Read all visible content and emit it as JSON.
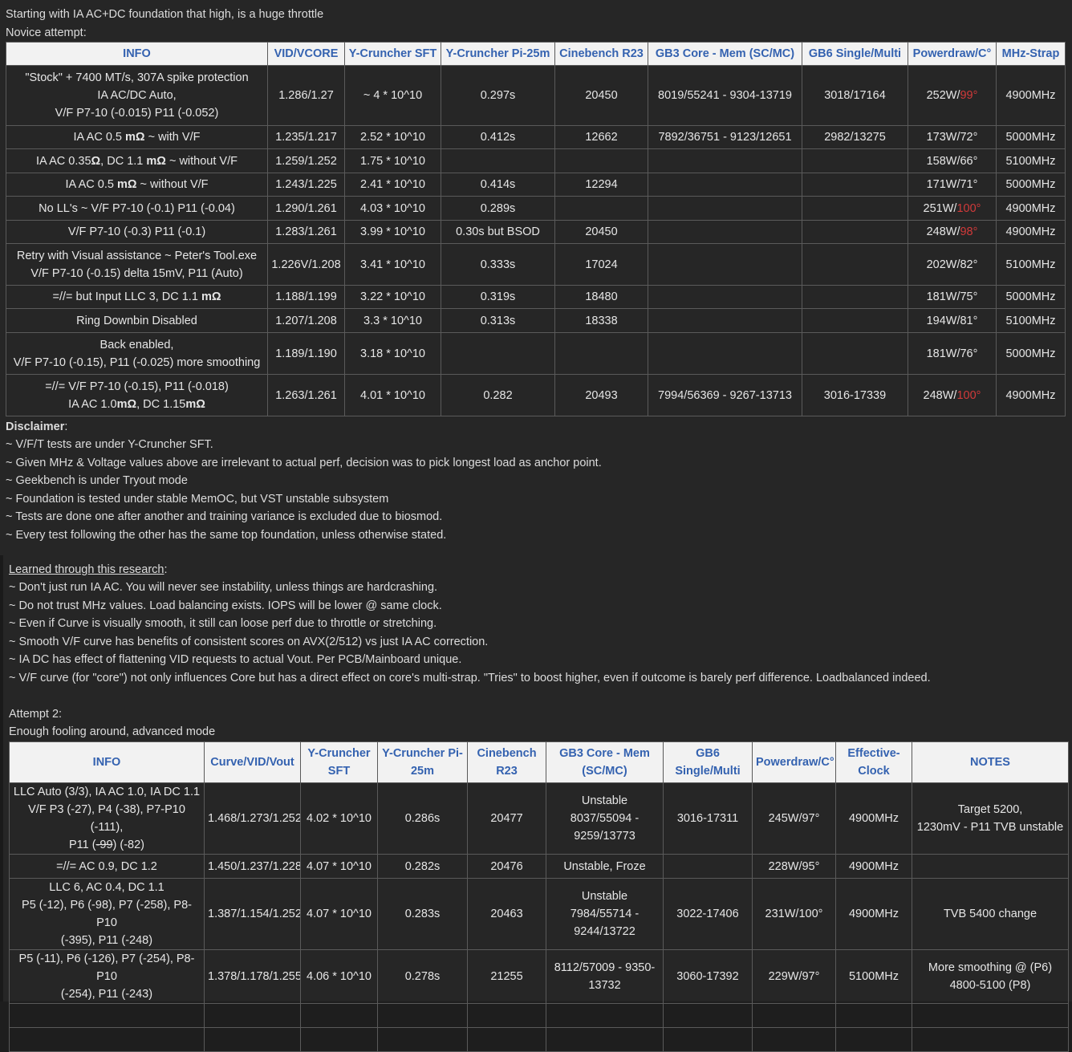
{
  "intro": {
    "line1": "Starting with IA AC+DC foundation that high, is a huge throttle",
    "line2": "Novice attempt:"
  },
  "table1": {
    "headers": [
      "INFO",
      "VID/VCORE",
      "Y-Cruncher SFT",
      "Y-Cruncher Pi-25m",
      "Cinebench R23",
      "GB3 Core - Mem (SC/MC)",
      "GB6 Single/Multi",
      "Powerdraw/C°",
      "MHz-Strap"
    ],
    "rows": [
      {
        "info": [
          "\"Stock\" + 7400 MT/s, 307A spike protection",
          "IA AC/DC Auto,",
          "V/F P7-10 (-0.015) P11 (-0.052)"
        ],
        "vid": "1.286/1.27",
        "sft": "~ 4 * 10^10",
        "pi": "0.297s",
        "cb": "20450",
        "gb3": "8019/55241 - 9304-13719",
        "gb6": "3018/17164",
        "pw": "252W/",
        "temp": "99°",
        "hot": true,
        "mhz": "4900MHz"
      },
      {
        "info_pre": "IA AC 0.5 ",
        "info_bold": "mΩ",
        "info_post": " ~ with V/F",
        "vid": "1.235/1.217",
        "sft": "2.52 * 10^10",
        "pi": "0.412s",
        "cb": "12662",
        "gb3": "7892/36751 - 9123/12651",
        "gb6": "2982/13275",
        "pw": "173W/",
        "temp": "72°",
        "hot": false,
        "mhz": "5000MHz"
      },
      {
        "info_pre": "IA AC 0.35",
        "info_bold": "Ω",
        "info_mid": ", DC 1.1 ",
        "info_bold2": "mΩ",
        "info_post": " ~ without V/F",
        "vid": "1.259/1.252",
        "sft": "1.75 * 10^10",
        "pi": "",
        "cb": "",
        "gb3": "",
        "gb6": "",
        "pw": "158W/",
        "temp": "66°",
        "hot": false,
        "mhz": "5100MHz"
      },
      {
        "info_pre": "IA AC 0.5 ",
        "info_bold": "mΩ",
        "info_post": " ~ without V/F",
        "vid": "1.243/1.225",
        "sft": "2.41 * 10^10",
        "pi": "0.414s",
        "cb": "12294",
        "gb3": "",
        "gb6": "",
        "pw": "171W/",
        "temp": "71°",
        "hot": false,
        "mhz": "5000MHz"
      },
      {
        "info": [
          "No LL's ~ V/F P7-10 (-0.1) P11 (-0.04)"
        ],
        "vid": "1.290/1.261",
        "sft": "4.03 * 10^10",
        "pi": "0.289s",
        "cb": "",
        "gb3": "",
        "gb6": "",
        "pw": "251W/",
        "temp": "100°",
        "hot": true,
        "mhz": "4900MHz"
      },
      {
        "info": [
          "V/F P7-10 (-0.3) P11 (-0.1)"
        ],
        "vid": "1.283/1.261",
        "sft": "3.99 * 10^10",
        "pi": "0.30s but BSOD",
        "cb": "20450",
        "gb3": "",
        "gb6": "",
        "pw": "248W/",
        "temp": "98°",
        "hot": true,
        "mhz": "4900MHz"
      },
      {
        "info": [
          "Retry with Visual assistance ~ Peter's Tool.exe",
          "V/F P7-10 (-0.15) delta 15mV, P11 (Auto)"
        ],
        "vid": "1.226V/1.208",
        "sft": "3.41 * 10^10",
        "pi": "0.333s",
        "cb": "17024",
        "gb3": "",
        "gb6": "",
        "pw": "202W/",
        "temp": "82°",
        "hot": false,
        "mhz": "5100MHz"
      },
      {
        "info_pre": "=//= but Input LLC 3, DC 1.1 ",
        "info_bold": "mΩ",
        "info_post": "",
        "vid": "1.188/1.199",
        "sft": "3.22 * 10^10",
        "pi": "0.319s",
        "cb": "18480",
        "gb3": "",
        "gb6": "",
        "pw": "181W/",
        "temp": "75°",
        "hot": false,
        "mhz": "5000MHz"
      },
      {
        "info": [
          "Ring Downbin Disabled"
        ],
        "vid": "1.207/1.208",
        "sft": "3.3 * 10^10",
        "pi": "0.313s",
        "cb": "18338",
        "gb3": "",
        "gb6": "",
        "pw": "194W/",
        "temp": "81°",
        "hot": false,
        "mhz": "5100MHz"
      },
      {
        "info": [
          "Back enabled,",
          "V/F P7-10 (-0.15), P11 (-0.025) more smoothing"
        ],
        "vid": "1.189/1.190",
        "sft": "3.18 * 10^10",
        "pi": "",
        "cb": "",
        "gb3": "",
        "gb6": "",
        "pw": "181W/",
        "temp": "76°",
        "hot": false,
        "mhz": "5000MHz"
      },
      {
        "info_l1": "=//= V/F P7-10 (-0.15), P11 (-0.018)",
        "info_l2_pre": "IA AC 1.0",
        "info_l2_b1": "mΩ",
        "info_l2_mid": ", DC 1.15",
        "info_l2_b2": "mΩ",
        "vid": "1.263/1.261",
        "sft": "4.01 * 10^10",
        "pi": "0.282",
        "cb": "20493",
        "gb3": "7994/56369 - 9267-13713",
        "gb6": "3016-17339",
        "pw": "248W/",
        "temp": "100°",
        "hot": true,
        "mhz": "4900MHz"
      }
    ]
  },
  "disclaimer": {
    "title": "Disclaimer",
    "colon": ":",
    "lines": [
      "~ V/F/T tests are under Y-Cruncher SFT.",
      "~ Given MHz & Voltage values above are irrelevant to actual perf, decision was to pick longest load as anchor point.",
      "~ Geekbench is under Tryout mode",
      "~ Foundation is tested under stable MemOC, but VST unstable subsystem",
      "~ Tests are done one after another and training variance is excluded due to biosmod.",
      "~ Every test following the other has the same top foundation, unless otherwise stated."
    ]
  },
  "learned": {
    "title": "Learned through this research",
    "colon": ":",
    "lines": [
      "~ Don't just run IA AC. You will never see instability, unless things are hardcrashing.",
      "~ Do not trust MHz values. Load balancing exists. IOPS will be lower @ same clock.",
      "~ Even if Curve is visually smooth, it still can loose perf due to throttle or stretching.",
      "~ Smooth V/F curve has benefits of consistent scores on AVX(2/512) vs just IA AC correction.",
      "~ IA DC has effect of flattening VID requests to actual Vout. Per PCB/Mainboard unique.",
      "~ V/F curve (for \"core\") not only influences Core but has a direct effect on core's multi-strap. \"Tries\" to boost higher, even if outcome is barely perf difference. Loadbalanced indeed."
    ]
  },
  "attempt2": {
    "line1": "Attempt 2:",
    "line2": "Enough fooling around, advanced mode"
  },
  "table2": {
    "headers": [
      "INFO",
      "Curve/VID/Vout",
      "Y-Cruncher SFT",
      "Y-Cruncher Pi-25m",
      "Cinebench R23",
      "GB3 Core - Mem (SC/MC)",
      "GB6 Single/Multi",
      "Powerdraw/C°",
      "Effective-Clock",
      "NOTES"
    ],
    "rows": [
      {
        "info_l1": "LLC Auto (3/3), IA AC 1.0, IA DC 1.1",
        "info_l2": "V/F P3 (-27), P4 (-38), P7-P10 (-111),",
        "info_l3a": "P11 (",
        "info_l3s": "-99",
        "info_l3b": ") (-82)",
        "curve": "1.468/1.273/1.252",
        "sft": "4.02 * 10^10",
        "pi": "0.286s",
        "cb": "20477",
        "gb3": [
          "Unstable",
          "8037/55094 -",
          "9259/13773"
        ],
        "gb6": "3016-17311",
        "pw": "245W/97°",
        "clk": "4900MHz",
        "notes": [
          "Target 5200,",
          "1230mV - P11 TVB unstable"
        ]
      },
      {
        "info": [
          "=//= AC 0.9, DC 1.2"
        ],
        "curve": "1.450/1.237/1.228",
        "sft": "4.07 * 10^10",
        "pi": "0.282s",
        "cb": "20476",
        "gb3": [
          "Unstable, Froze"
        ],
        "gb6": "",
        "pw": "228W/95°",
        "clk": "4900MHz",
        "notes": [
          ""
        ]
      },
      {
        "info": [
          "LLC 6, AC 0.4, DC 1.1",
          "P5 (-12), P6 (-98), P7 (-258), P8-P10",
          "(-395), P11 (-248)"
        ],
        "curve": "1.387/1.154/1.252",
        "sft": "4.07 * 10^10",
        "pi": "0.283s",
        "cb": "20463",
        "gb3": [
          "Unstable",
          "7984/55714 -",
          "9244/13722"
        ],
        "gb6": "3022-17406",
        "pw": "231W/100°",
        "clk": "4900MHz",
        "notes": [
          "TVB 5400 change"
        ]
      },
      {
        "info": [
          "P5 (-11), P6 (-126), P7 (-254), P8-P10",
          "(-254), P11 (-243)"
        ],
        "curve": "1.378/1.178/1.255",
        "sft": "4.06 * 10^10",
        "pi": "0.278s",
        "cb": "21255",
        "gb3": [
          "8112/57009 - 9350-",
          "13732"
        ],
        "gb6": "3060-17392",
        "pw": "229W/97°",
        "clk": "5100MHz",
        "notes": [
          "More smoothing @ (P6)",
          "4800-5100 (P8)"
        ]
      }
    ]
  }
}
